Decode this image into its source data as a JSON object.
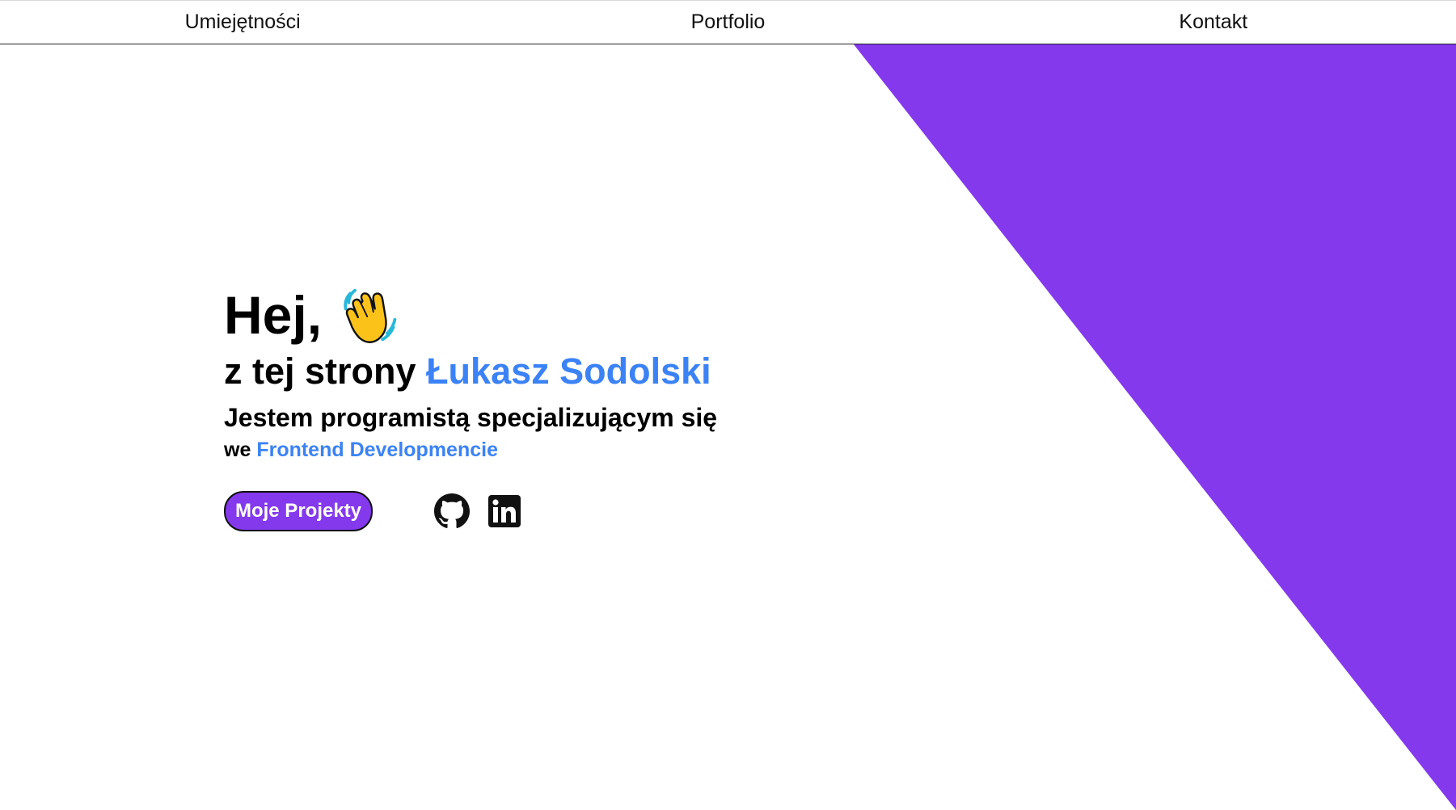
{
  "nav": {
    "items": [
      "Umiejętności",
      "Portfolio",
      "Kontakt"
    ]
  },
  "hero": {
    "greeting": "Hej,",
    "intro_prefix": "z tej strony",
    "name": "Łukasz Sodolski",
    "job_line": "Jestem programistą specjalizującym się",
    "field_prefix": "we",
    "field": "Frontend Developmencie",
    "cta_label": "Moje Projekty",
    "wave_icon": "waving-hand-icon"
  },
  "social": {
    "icons": [
      "github-icon",
      "linkedin-icon"
    ]
  },
  "colors": {
    "accent_purple": "#8439ed",
    "accent_blue": "#3b82f6",
    "text": "#000000",
    "background": "#ffffff"
  }
}
